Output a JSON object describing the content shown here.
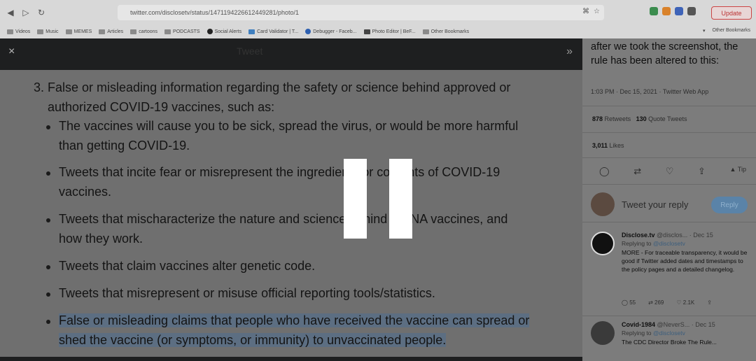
{
  "browser": {
    "url": "twitter.com/disclosetv/status/1471194226612449281/photo/1",
    "update_label": "Update",
    "bookmarks": [
      "Videos",
      "Music",
      "MEMES",
      "Articles",
      "cartoons",
      "PODCASTS",
      "Social Alerts",
      "Card Validator | T...",
      "Debugger - Faceb...",
      "Photo Editor | BeF...",
      "Other Bookmarks"
    ],
    "bookmarks_right": "Other Bookmarks"
  },
  "viewer": {
    "header_title": "Tweet",
    "close_glyph": "×",
    "expand_glyph": "»"
  },
  "document": {
    "item_intro_line1": "3. False or misleading information regarding the safety or science behind approved or",
    "item_intro_line2": "authorized COVID-19 vaccines, such as:",
    "bullets": [
      {
        "l1": "The vaccines will cause you to be sick, spread the virus, or would be more harmful",
        "l2": "than getting COVID-19."
      },
      {
        "l1": "Tweets that incite fear or misrepresent the ingredients or contents of COVID-19",
        "l2": "vaccines."
      },
      {
        "l1": "Tweets that mischaracterize the nature and science behind mRNA vaccines, and",
        "l2": "how they work."
      },
      {
        "l1": "Tweets that claim vaccines alter genetic code."
      },
      {
        "l1": "Tweets that misrepresent or misuse official reporting tools/statistics."
      },
      {
        "l1": "False or misleading claims that people who have received the vaccine can spread or",
        "l2": "shed the vaccine (or symptoms, or immunity) to unvaccinated people."
      }
    ]
  },
  "sidebar": {
    "tweet_text": "after we took the screenshot, the rule has been altered to this:",
    "meta": "1:03 PM · Dec 15, 2021 · Twitter Web App",
    "retweets_count": "878",
    "retweets_label": "Retweets",
    "quotes_count": "130",
    "quotes_label": "Quote Tweets",
    "likes_count": "3,011",
    "likes_label": "Likes",
    "reply_placeholder": "Tweet your reply",
    "reply_button": "Reply",
    "replies": [
      {
        "name": "Disclose.tv",
        "handle": "@disclos...",
        "date": "· Dec 15",
        "replying_prefix": "Replying to",
        "replying_to": "@disclosetv",
        "text": "MORE - For traceable transparency, it would be good if Twitter added dates and timestamps to the policy pages and a detailed changelog.",
        "reply_count": "55",
        "retweet_count": "269",
        "like_count": "2.1K"
      },
      {
        "name": "Covid-1984",
        "handle": "@NeverS...",
        "date": "· Dec 15",
        "replying_prefix": "Replying to",
        "replying_to": "@disclosetv",
        "text": "The CDC Director Broke The Rule..."
      }
    ]
  },
  "colors": {
    "overlay_page": "#6f6f6f",
    "highlight": "#5c6e82",
    "reply_button": "#5a83a8",
    "pause_bars": "#ffffff"
  }
}
